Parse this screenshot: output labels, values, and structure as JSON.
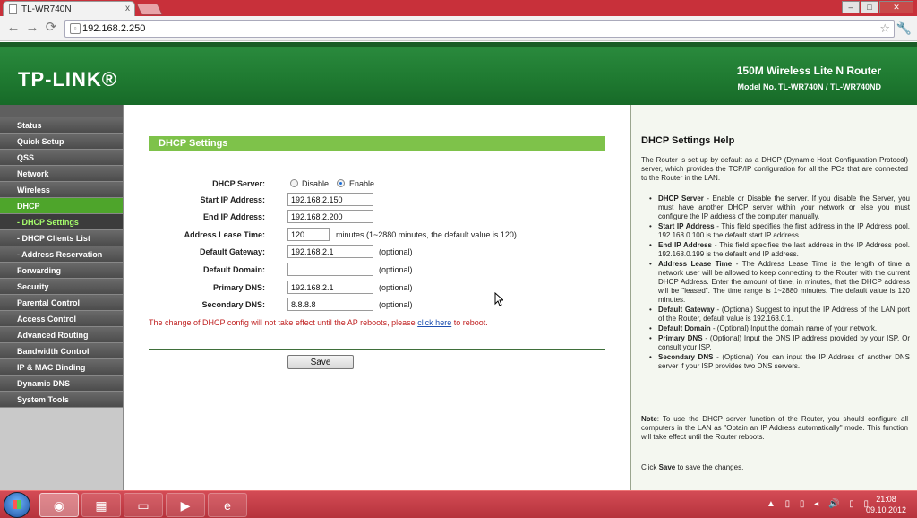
{
  "browser": {
    "tab_title": "TL-WR740N",
    "tab_close": "x",
    "window_buttons": [
      "–",
      "□",
      "✕"
    ],
    "nav": {
      "back": "←",
      "forward": "→",
      "reload": "⟳"
    },
    "address": "192.168.2.250",
    "star": "☆",
    "menu": "🔧"
  },
  "header": {
    "logo": "TP-LINK®",
    "product": "150M Wireless Lite N Router",
    "model": "Model No. TL-WR740N / TL-WR740ND"
  },
  "menu": {
    "items": [
      {
        "label": "Status",
        "type": "main",
        "active": false
      },
      {
        "label": "Quick Setup",
        "type": "main",
        "active": false
      },
      {
        "label": "QSS",
        "type": "main",
        "active": false
      },
      {
        "label": "Network",
        "type": "main",
        "active": false
      },
      {
        "label": "Wireless",
        "type": "main",
        "active": false
      },
      {
        "label": "DHCP",
        "type": "main",
        "active": true
      },
      {
        "label": "- DHCP Settings",
        "type": "sub",
        "active": true
      },
      {
        "label": "- DHCP Clients List",
        "type": "sub",
        "active": false
      },
      {
        "label": "- Address Reservation",
        "type": "sub",
        "active": false
      },
      {
        "label": "Forwarding",
        "type": "main",
        "active": false
      },
      {
        "label": "Security",
        "type": "main",
        "active": false
      },
      {
        "label": "Parental Control",
        "type": "main",
        "active": false
      },
      {
        "label": "Access Control",
        "type": "main",
        "active": false
      },
      {
        "label": "Advanced Routing",
        "type": "main",
        "active": false
      },
      {
        "label": "Bandwidth Control",
        "type": "main",
        "active": false
      },
      {
        "label": "IP & MAC Binding",
        "type": "main",
        "active": false
      },
      {
        "label": "Dynamic DNS",
        "type": "main",
        "active": false
      },
      {
        "label": "System Tools",
        "type": "main",
        "active": false
      }
    ]
  },
  "main": {
    "title": "DHCP Settings",
    "server_label": "DHCP Server:",
    "disable_label": "Disable",
    "enable_label": "Enable",
    "start_label": "Start IP Address:",
    "start_value": "192.168.2.150",
    "end_label": "End IP Address:",
    "end_value": "192.168.2.200",
    "lease_label": "Address Lease Time:",
    "lease_value": "120",
    "lease_note": "minutes (1~2880 minutes, the default value is 120)",
    "gateway_label": "Default Gateway:",
    "gateway_value": "192.168.2.1",
    "domain_label": "Default Domain:",
    "domain_value": "",
    "pdns_label": "Primary DNS:",
    "pdns_value": "192.168.2.1",
    "sdns_label": "Secondary DNS:",
    "sdns_value": "8.8.8.8",
    "optional": "(optional)",
    "warning_before": "The change of DHCP config will not take effect until the AP reboots, please ",
    "warning_link": "click here",
    "warning_after": " to reboot.",
    "save_label": "Save"
  },
  "help": {
    "title": "DHCP Settings Help",
    "intro": "The Router is set up by default as a DHCP (Dynamic Host Configuration Protocol) server, which provides the TCP/IP configuration for all the PCs that are connected to the Router in the LAN.",
    "items": [
      {
        "term": "DHCP Server",
        "text": " - Enable or Disable the server. If you disable the Server, you must have another DHCP server within your network or else you must configure the IP address of the computer manually."
      },
      {
        "term": "Start IP Address",
        "text": " - This field specifies the first address in the IP Address pool. 192.168.0.100 is the default start IP address."
      },
      {
        "term": "End IP Address",
        "text": " - This field specifies the last address in the IP Address pool. 192.168.0.199 is the default end IP address."
      },
      {
        "term": "Address Lease Time",
        "text": " - The Address Lease Time is the length of time a network user will be allowed to keep connecting to the Router with the current DHCP Address. Enter the amount of time, in minutes, that the DHCP address will be \"leased\". The time range is 1~2880 minutes. The default value is 120 minutes."
      },
      {
        "term": "Default Gateway",
        "text": " - (Optional) Suggest to input the IP Address of the LAN port of the Router, default value is 192.168.0.1."
      },
      {
        "term": "Default Domain",
        "text": " - (Optional) Input the domain name of your network."
      },
      {
        "term": "Primary DNS",
        "text": " - (Optional) Input the DNS IP address provided by your ISP. Or consult your ISP."
      },
      {
        "term": "Secondary DNS",
        "text": " - (Optional) You can input the IP Address of another DNS server if your ISP provides two DNS servers."
      }
    ],
    "note_term": "Note",
    "note_text": ": To use the DHCP server function of the Router, you should configure all computers in the LAN as \"Obtain an IP Address automatically\" mode. This function will take effect until the Router reboots.",
    "click_before": "Click ",
    "click_term": "Save",
    "click_after": " to save the changes."
  },
  "taskbar": {
    "time": "21:08",
    "date": "09.10.2012",
    "tray": "▲ ▯ ▯ ◂ 🔊 ▯ ▯"
  }
}
